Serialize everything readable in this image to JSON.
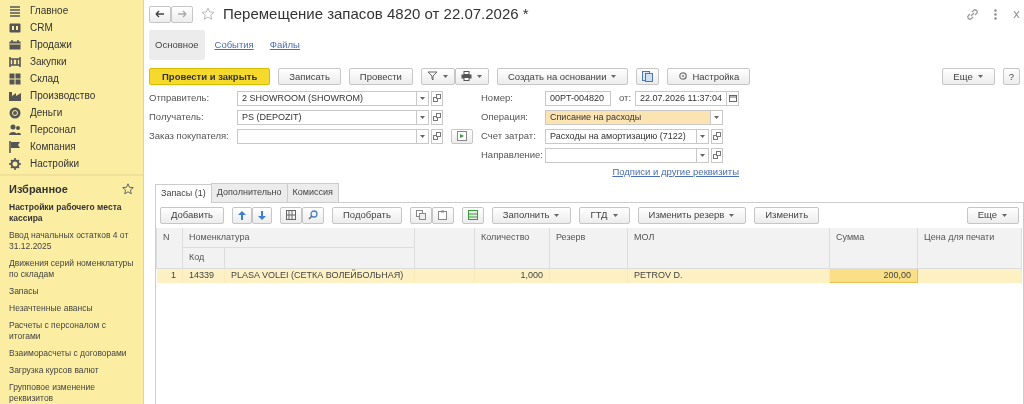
{
  "sidebar": {
    "sections": [
      {
        "label": "Главное"
      },
      {
        "label": "CRM"
      },
      {
        "label": "Продажи"
      },
      {
        "label": "Закупки"
      },
      {
        "label": "Склад"
      },
      {
        "label": "Производство"
      },
      {
        "label": "Деньги"
      },
      {
        "label": "Персонал"
      },
      {
        "label": "Компания"
      },
      {
        "label": "Настройки"
      }
    ],
    "favorites": {
      "title": "Избранное",
      "items": [
        {
          "label": "Настройки рабочего места кассира",
          "emphasized": true
        },
        {
          "label": "Ввод начальных остатков 4 от 31.12.2025",
          "emphasized": false
        },
        {
          "label": "Движения серий номенклатуры по складам",
          "emphasized": false
        },
        {
          "label": "Запасы",
          "emphasized": false
        },
        {
          "label": "Незачтенные авансы",
          "emphasized": false
        },
        {
          "label": "Расчеты с персоналом с итогами",
          "emphasized": false
        },
        {
          "label": "Взаиморасчеты с договорами",
          "emphasized": false
        },
        {
          "label": "Загрузка курсов валют",
          "emphasized": false
        },
        {
          "label": "Групповое изменение реквизитов",
          "emphasized": false
        }
      ]
    }
  },
  "header": {
    "title": "Перемещение запасов 4820 от 22.07.2026 *",
    "help": "?"
  },
  "form_tabs": [
    {
      "label": "Основное",
      "selected": true
    },
    {
      "label": "События",
      "selected": false
    },
    {
      "label": "Файлы",
      "selected": false
    }
  ],
  "command_bar": {
    "post_and_close": "Провести и закрыть",
    "save": "Записать",
    "post": "Провести",
    "create_based_on": "Создать на основании",
    "settings": "Настройка",
    "more": "Еще"
  },
  "fields_left": [
    {
      "label": "Отправитель:",
      "value": "2  SHOWROOM (SHOWROM)",
      "kind": "choice",
      "highlighted": false
    },
    {
      "label": "Получатель:",
      "value": "PS (DEPOZIT)",
      "kind": "choice",
      "highlighted": false
    },
    {
      "label": "Заказ покупателя:",
      "kind": "choice_extra",
      "highlighted": false
    }
  ],
  "fields_right": [
    {
      "label": "Номер:",
      "value": "00PT-004820",
      "kind": "number",
      "date_label": "от:",
      "date_value": "22.07.2026 11:37:04",
      "highlighted": false
    },
    {
      "label": "Операция:",
      "value": "Списание на расходы",
      "kind": "list",
      "highlighted": true
    },
    {
      "label": "Счет затрат:",
      "value": "Расходы на амортизацию (7122)",
      "kind": "choice",
      "highlighted": false
    },
    {
      "label": "Направление:",
      "kind": "choice",
      "highlighted": false
    }
  ],
  "details_link": "Подписи и другие реквизиты",
  "table_tabs": [
    {
      "label": "Запасы (1)",
      "selected": true
    },
    {
      "label": "Дополнительно",
      "selected": false
    },
    {
      "label": "Комиссия",
      "selected": false
    }
  ],
  "table_toolbar": {
    "add": "Добавить",
    "pick": "Подобрать",
    "fill": "Заполнить",
    "gtd": "ГТД",
    "change_reserve": "Изменить резерв",
    "change": "Изменить",
    "more": "Еще"
  },
  "table": {
    "header": {
      "n": "N",
      "nomenclature": "Номенклатура",
      "code": "Код",
      "quantity": "Количество",
      "reserve": "Резерв",
      "mol": "МОЛ",
      "sum": "Сумма",
      "print_price": "Цена для печати"
    },
    "rows": [
      {
        "n": "1",
        "code": "14339",
        "name": "PLASA VOLEI (СЕТКА ВОЛЕЙБОЛЬНАЯ)",
        "quantity": "1,000",
        "mol": "PETROV D.",
        "sum": "200,00",
        "selected": true,
        "sum_focused": true
      }
    ]
  }
}
